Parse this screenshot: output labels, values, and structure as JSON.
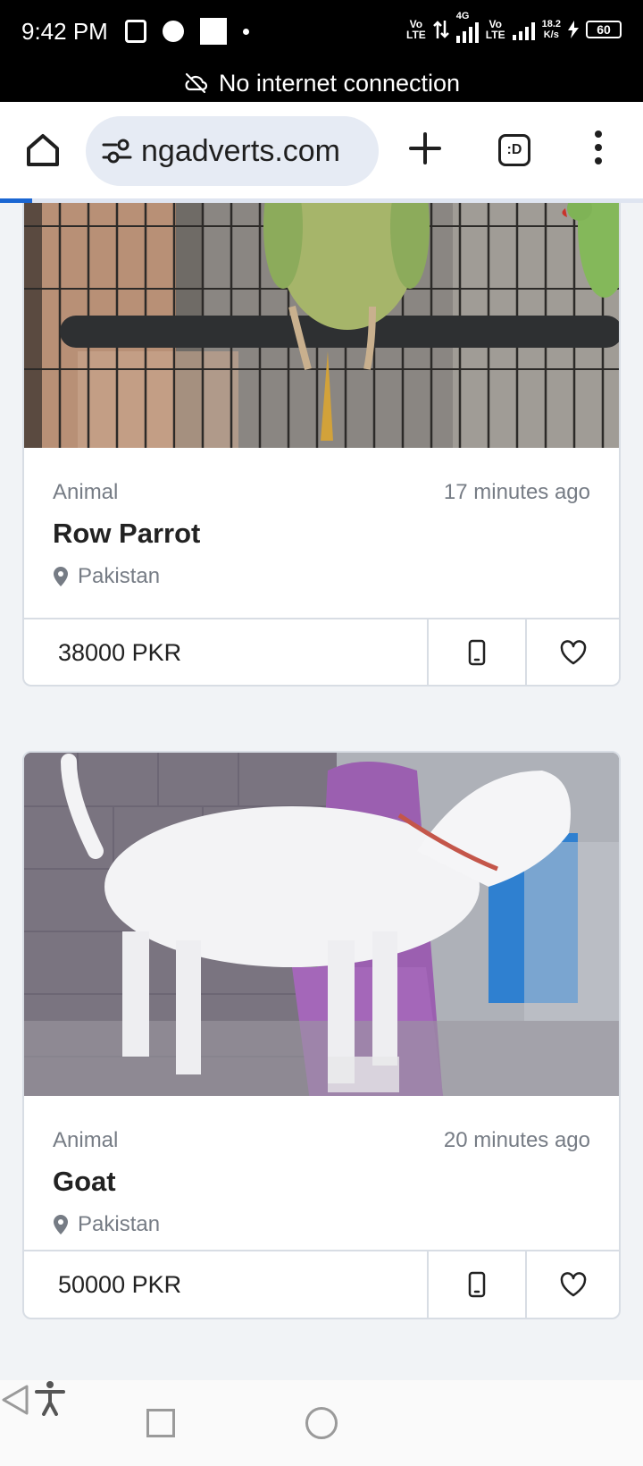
{
  "status_bar": {
    "time": "9:42 PM",
    "network_1": "Vo\nLTE",
    "network_gen": "4G",
    "network_2": "Vo\nLTE",
    "speed_value": "18.2",
    "speed_unit": "K/s",
    "battery": "60"
  },
  "offline_banner": {
    "text": "No internet connection",
    "icon": "cloud-off-icon"
  },
  "browser": {
    "url": "ngadverts.com",
    "tabs_label": ":D",
    "page_load_progress": 0.05
  },
  "listings": [
    {
      "category": "Animal",
      "time_ago": "17 minutes ago",
      "title": "Row Parrot",
      "location": "Pakistan",
      "price": "38000 PKR",
      "image": "parrot-photo"
    },
    {
      "category": "Animal",
      "time_ago": "20 minutes ago",
      "title": "Goat",
      "location": "Pakistan",
      "price": "50000 PKR",
      "image": "goat-photo"
    }
  ],
  "nav_bar": {
    "buttons": [
      "recents-button",
      "home-button",
      "back-button",
      "accessibility-button"
    ]
  },
  "colors": {
    "accent": "#1a66d2",
    "page_bg": "#f1f3f6",
    "muted_text": "#767c85",
    "url_bar_bg": "#e6ebf4"
  }
}
